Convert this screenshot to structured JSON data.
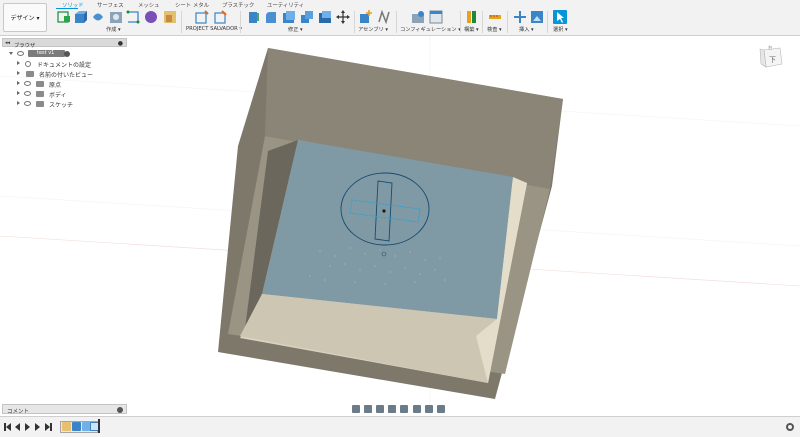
{
  "toolbar": {
    "workspace_button": "デザイン ▾",
    "tabs": [
      "ソリッド",
      "サーフェス",
      "メッシュ",
      "シート メタル",
      "プラスチック",
      "ユーティリティ"
    ],
    "active_tab": "ソリッド",
    "groups": {
      "create": "作成 ▾",
      "project_salvador": "PROJECT SALVADOR ▾",
      "modify": "修正 ▾",
      "assemble": "アセンブリ ▾",
      "configure": "コンフィギュレーション ▾",
      "construct": "構築 ▾",
      "inspect": "検査 ▾",
      "insert": "挿入 ▾",
      "select": "選択 ▾"
    },
    "accent_color": "#0696d7"
  },
  "browser": {
    "title": "ブラウザ",
    "root": "test v1",
    "items": [
      "ドキュメントの設定",
      "名前の付いたビュー",
      "原点",
      "ボディ",
      "スケッチ"
    ]
  },
  "viewcube": {
    "face_label": "下",
    "top_label": "右"
  },
  "comment_panel": {
    "label": "コメント"
  },
  "colors": {
    "model_outer": "#827c6e",
    "model_top": "#8b8577",
    "floor": "#7f9aa5",
    "sketch_line": "#1a4a6e",
    "selection": "#2a9fd6"
  }
}
